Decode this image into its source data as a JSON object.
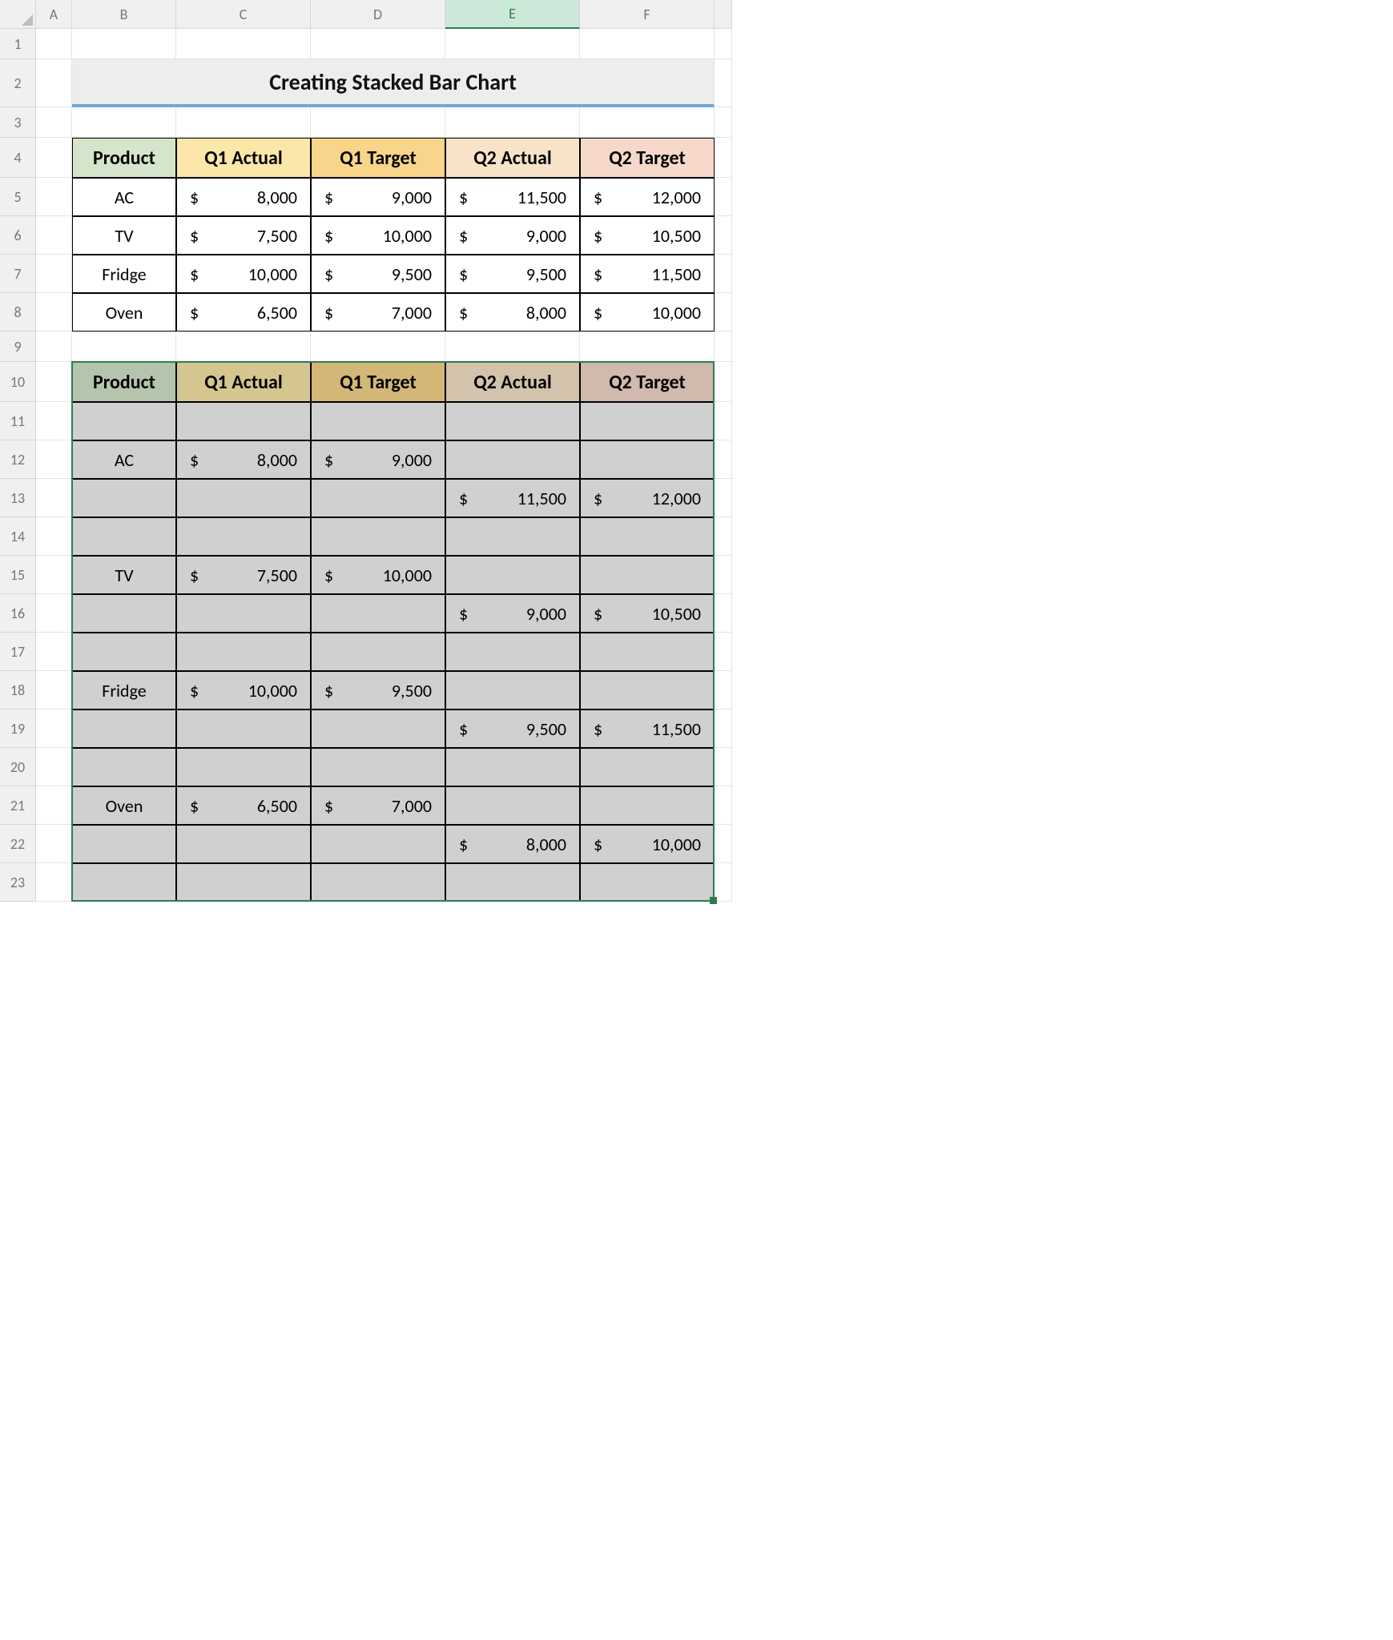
{
  "columns": [
    "A",
    "B",
    "C",
    "D",
    "E",
    "F"
  ],
  "selected_column": "E",
  "rows": [
    "1",
    "2",
    "3",
    "4",
    "5",
    "6",
    "7",
    "8",
    "9",
    "10",
    "11",
    "12",
    "13",
    "14",
    "15",
    "16",
    "17",
    "18",
    "19",
    "20",
    "21",
    "22",
    "23"
  ],
  "title": "Creating Stacked Bar Chart",
  "headers": {
    "product": "Product",
    "q1a": "Q1 Actual",
    "q1t": "Q1 Target",
    "q2a": "Q2 Actual",
    "q2t": "Q2 Target"
  },
  "table1": [
    {
      "product": "AC",
      "q1a": "8,000",
      "q1t": "9,000",
      "q2a": "11,500",
      "q2t": "12,000"
    },
    {
      "product": "TV",
      "q1a": "7,500",
      "q1t": "10,000",
      "q2a": "9,000",
      "q2t": "10,500"
    },
    {
      "product": "Fridge",
      "q1a": "10,000",
      "q1t": "9,500",
      "q2a": "9,500",
      "q2t": "11,500"
    },
    {
      "product": "Oven",
      "q1a": "6,500",
      "q1t": "7,000",
      "q2a": "8,000",
      "q2t": "10,000"
    }
  ],
  "table2_rows": [
    {},
    {
      "product": "AC",
      "q1a": "8,000",
      "q1t": "9,000"
    },
    {
      "q2a": "11,500",
      "q2t": "12,000"
    },
    {},
    {
      "product": "TV",
      "q1a": "7,500",
      "q1t": "10,000"
    },
    {
      "q2a": "9,000",
      "q2t": "10,500"
    },
    {},
    {
      "product": "Fridge",
      "q1a": "10,000",
      "q1t": "9,500"
    },
    {
      "q2a": "9,500",
      "q2t": "11,500"
    },
    {},
    {
      "product": "Oven",
      "q1a": "6,500",
      "q1t": "7,000"
    },
    {
      "q2a": "8,000",
      "q2t": "10,000"
    },
    {}
  ],
  "currency_sign": "$"
}
